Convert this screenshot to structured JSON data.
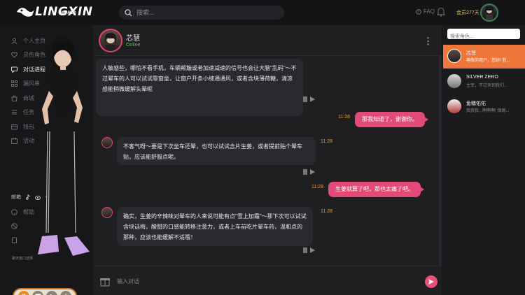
{
  "brand": {
    "name": "LINGXIN",
    "sub": "WORLD"
  },
  "search": {
    "placeholder": "搜索..."
  },
  "topbar": {
    "faq": "FAQ",
    "vip_text": "会员277天"
  },
  "sidebar": {
    "items": [
      {
        "label": "个人主页",
        "icon": "user-icon"
      },
      {
        "label": "灵伤角色",
        "icon": "heart-icon"
      },
      {
        "label": "对话进程",
        "icon": "chat-icon",
        "active": true
      },
      {
        "label": "漏风串",
        "icon": "grid-icon"
      },
      {
        "label": "商城",
        "icon": "store-icon"
      },
      {
        "label": "任务",
        "icon": "task-icon"
      },
      {
        "label": "钱包",
        "icon": "wallet-icon"
      },
      {
        "label": "活动",
        "icon": "event-icon"
      }
    ],
    "social_label": "邮箱",
    "help": "帮助",
    "extra_items": [
      "",
      ""
    ],
    "hint": "聊天窗口选择"
  },
  "chat": {
    "name": "芯慧",
    "status": "Online",
    "messages": [
      {
        "role": "bot",
        "text": "人敏感些，哪怕不看手机，车辆颠簸或者加速减速的信号也会让大脑\"乱码\"～不过晕车的人可以试试靠窗坐，让窗户开条小缝通通风，或者含块薄荷糖，清凉感能稍微缓解头晕呢"
      },
      {
        "role": "user",
        "text": "那我知道了，谢谢你。",
        "time": "11:28"
      },
      {
        "role": "bot",
        "text": "不客气呀～要是下次坐车还晕，也可以试试含片生姜，或者提前贴个晕车贴，应该能舒服点呢。",
        "time": "11:28"
      },
      {
        "role": "user",
        "text": "生姜就算了吧，那也太痛了吧。",
        "time": "11:28"
      },
      {
        "role": "bot",
        "text": "确实，生姜的辛辣味对晕车的人来说可能有点\"雪上加霜\"～那下次可以试试含块话梅，酸甜的口感能转移注意力，或者上车前吃片晕车药，温和点的那种，应该也能缓解不适哦！",
        "time": "11:28"
      }
    ],
    "input_placeholder": "输入对话"
  },
  "contacts": {
    "search_placeholder": "搜索角色...",
    "items": [
      {
        "name": "芯慧",
        "preview": "尊敬的用户，您好! 我...",
        "active": true
      },
      {
        "name": "SILVER ZERO",
        "preview": "主宰，不过来到我们..."
      },
      {
        "name": "鱼鳝佑佑",
        "preview": "我我我...啊啊啊! 保姆..."
      }
    ]
  },
  "colors": {
    "accent": "#e24b78",
    "active_contact": "#f0773a",
    "time": "#e8983a",
    "online": "#5fbf5f"
  }
}
